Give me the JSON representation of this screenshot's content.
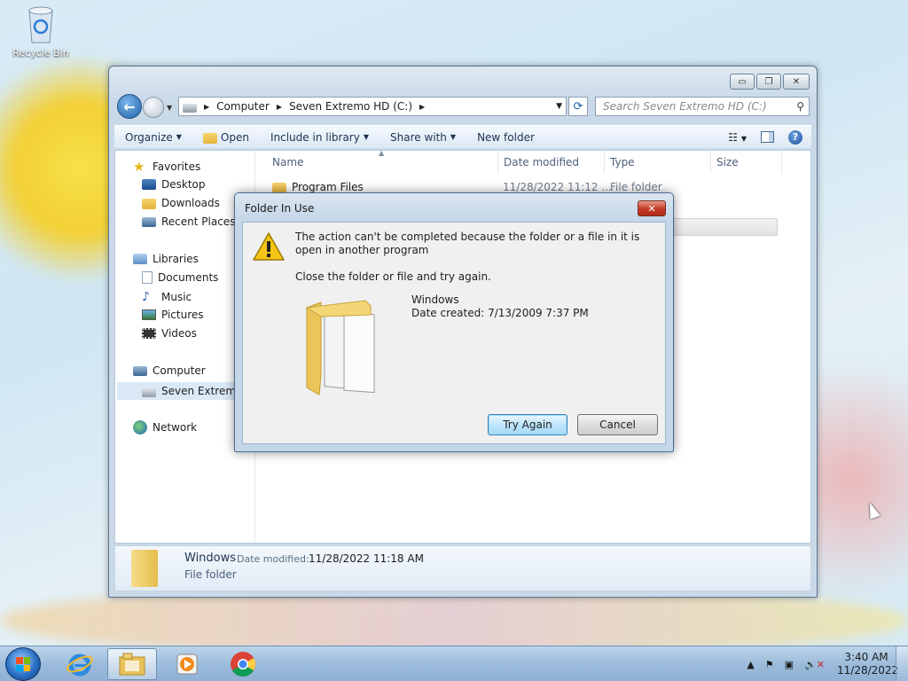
{
  "desktop": {
    "recycle_bin_label": "Recycle Bin"
  },
  "explorer": {
    "window_buttons": {
      "minimize": "▭",
      "restore": "❐",
      "close": "✕"
    },
    "address": {
      "segments": [
        "Computer",
        "Seven Extremo HD (C:)"
      ]
    },
    "search": {
      "placeholder": "Search Seven Extremo HD (C:)"
    },
    "toolbar": {
      "organize": "Organize",
      "open": "Open",
      "include_in_library": "Include in library",
      "share_with": "Share with",
      "new_folder": "New folder"
    },
    "nav_pane": {
      "favorites": "Favorites",
      "desktop": "Desktop",
      "downloads": "Downloads",
      "recent_places": "Recent Places",
      "libraries": "Libraries",
      "documents": "Documents",
      "music": "Music",
      "pictures": "Pictures",
      "videos": "Videos",
      "computer": "Computer",
      "drive": "Seven Extremo HD (C:)",
      "network": "Network"
    },
    "columns": {
      "name": "Name",
      "date_modified": "Date modified",
      "type": "Type",
      "size": "Size"
    },
    "files": [
      {
        "name": "Program Files",
        "date": "11/28/2022 11:12 ...",
        "type": "File folder"
      }
    ],
    "details_pane": {
      "name": "Windows",
      "date_modified_label": "Date modified:",
      "date_modified_value": "11/28/2022 11:18 AM",
      "type": "File folder"
    }
  },
  "dialog": {
    "title": "Folder In Use",
    "close_glyph": "✕",
    "message": "The action can't be completed because the folder or a file in it is open in another program",
    "instruction": "Close the folder or file and try again.",
    "item_name": "Windows",
    "item_date": "Date created: 7/13/2009 7:37 PM",
    "try_again": "Try Again",
    "cancel": "Cancel"
  },
  "taskbar": {
    "clock_time": "3:40 AM",
    "clock_date": "11/28/2022",
    "tray_chevron": "▲"
  }
}
